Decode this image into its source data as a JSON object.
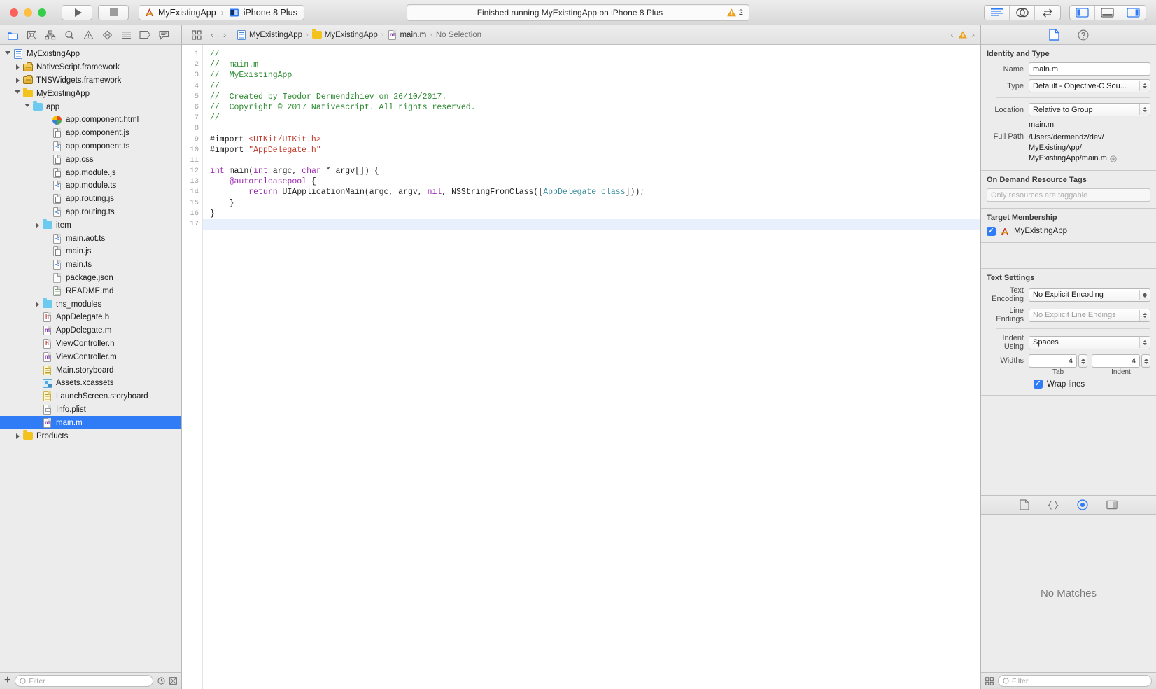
{
  "window": {
    "title": "MyExistingApp",
    "traffic_lights": [
      "close-red",
      "minimize-yellow",
      "zoom-green"
    ]
  },
  "toolbar": {
    "run_label": "Run",
    "stop_label": "Stop",
    "scheme_name": "MyExistingApp",
    "scheme_separator": "›",
    "destination": "iPhone 8 Plus",
    "status_message": "Finished running MyExistingApp on iPhone 8 Plus",
    "warning_count": "2",
    "editor_modes": [
      "standard-editor",
      "assistant-editor",
      "version-editor"
    ],
    "view_toggles": [
      "toggle-navigator",
      "toggle-debug-area",
      "toggle-utilities"
    ]
  },
  "navigator": {
    "tabs": [
      "project-navigator",
      "source-control-navigator",
      "symbol-navigator",
      "find-navigator",
      "issue-navigator",
      "test-navigator",
      "debug-navigator",
      "breakpoint-navigator",
      "report-navigator"
    ],
    "selected_tab": "project-navigator",
    "filter_placeholder": "Filter",
    "add_label": "+",
    "tree": [
      {
        "label": "MyExistingApp",
        "depth": 0,
        "icon": "project",
        "twisty": "open",
        "selected": false
      },
      {
        "label": "NativeScript.framework",
        "depth": 1,
        "icon": "framework",
        "twisty": "closed",
        "selected": false
      },
      {
        "label": "TNSWidgets.framework",
        "depth": 1,
        "icon": "framework",
        "twisty": "closed",
        "selected": false
      },
      {
        "label": "MyExistingApp",
        "depth": 1,
        "icon": "folder-yellow",
        "twisty": "open",
        "selected": false
      },
      {
        "label": "app",
        "depth": 2,
        "icon": "folder-blue",
        "twisty": "open",
        "selected": false
      },
      {
        "label": "app.component.html",
        "depth": 4,
        "icon": "html",
        "twisty": "none",
        "selected": false
      },
      {
        "label": "app.component.js",
        "depth": 4,
        "icon": "js",
        "twisty": "none",
        "selected": false
      },
      {
        "label": "app.component.ts",
        "depth": 4,
        "icon": "ts",
        "twisty": "none",
        "selected": false
      },
      {
        "label": "app.css",
        "depth": 4,
        "icon": "js",
        "twisty": "none",
        "selected": false
      },
      {
        "label": "app.module.js",
        "depth": 4,
        "icon": "js",
        "twisty": "none",
        "selected": false
      },
      {
        "label": "app.module.ts",
        "depth": 4,
        "icon": "ts",
        "twisty": "none",
        "selected": false
      },
      {
        "label": "app.routing.js",
        "depth": 4,
        "icon": "js",
        "twisty": "none",
        "selected": false
      },
      {
        "label": "app.routing.ts",
        "depth": 4,
        "icon": "ts",
        "twisty": "none",
        "selected": false
      },
      {
        "label": "item",
        "depth": 3,
        "icon": "folder-blue",
        "twisty": "closed",
        "selected": false
      },
      {
        "label": "main.aot.ts",
        "depth": 4,
        "icon": "ts",
        "twisty": "none",
        "selected": false
      },
      {
        "label": "main.js",
        "depth": 4,
        "icon": "js",
        "twisty": "none",
        "selected": false
      },
      {
        "label": "main.ts",
        "depth": 4,
        "icon": "ts",
        "twisty": "none",
        "selected": false
      },
      {
        "label": "package.json",
        "depth": 4,
        "icon": "json",
        "twisty": "none",
        "selected": false
      },
      {
        "label": "README.md",
        "depth": 4,
        "icon": "md",
        "twisty": "none",
        "selected": false
      },
      {
        "label": "tns_modules",
        "depth": 3,
        "icon": "folder-blue",
        "twisty": "closed",
        "selected": false
      },
      {
        "label": "AppDelegate.h",
        "depth": 3,
        "icon": "h",
        "twisty": "none",
        "selected": false
      },
      {
        "label": "AppDelegate.m",
        "depth": 3,
        "icon": "m",
        "twisty": "none",
        "selected": false
      },
      {
        "label": "ViewController.h",
        "depth": 3,
        "icon": "h",
        "twisty": "none",
        "selected": false
      },
      {
        "label": "ViewController.m",
        "depth": 3,
        "icon": "m",
        "twisty": "none",
        "selected": false
      },
      {
        "label": "Main.storyboard",
        "depth": 3,
        "icon": "storyboard",
        "twisty": "none",
        "selected": false
      },
      {
        "label": "Assets.xcassets",
        "depth": 3,
        "icon": "xcassets",
        "twisty": "none",
        "selected": false
      },
      {
        "label": "LaunchScreen.storyboard",
        "depth": 3,
        "icon": "storyboard",
        "twisty": "none",
        "selected": false
      },
      {
        "label": "Info.plist",
        "depth": 3,
        "icon": "plist",
        "twisty": "none",
        "selected": false
      },
      {
        "label": "main.m",
        "depth": 3,
        "icon": "m",
        "twisty": "none",
        "selected": true
      },
      {
        "label": "Products",
        "depth": 1,
        "icon": "folder-yellow",
        "twisty": "closed",
        "selected": false
      }
    ]
  },
  "editor": {
    "related_items_icon": "related-items-icon",
    "back_label": "‹",
    "forward_label": "›",
    "breadcrumbs": [
      {
        "label": "MyExistingApp",
        "icon": "project"
      },
      {
        "label": "MyExistingApp",
        "icon": "folder-yellow"
      },
      {
        "label": "main.m",
        "icon": "m"
      },
      {
        "label": "No Selection",
        "icon": "none"
      }
    ],
    "issue_prev": "‹",
    "issue_next": "›",
    "line_count": 17,
    "cursor_line": 17,
    "code_lines": [
      [
        {
          "t": "//",
          "c": "cm"
        }
      ],
      [
        {
          "t": "//  main.m",
          "c": "cm"
        }
      ],
      [
        {
          "t": "//  MyExistingApp",
          "c": "cm"
        }
      ],
      [
        {
          "t": "//",
          "c": "cm"
        }
      ],
      [
        {
          "t": "//  Created by Teodor Dermendzhiev on 26/10/2017.",
          "c": "cm"
        }
      ],
      [
        {
          "t": "//  Copyright © 2017 Nativescript. All rights reserved.",
          "c": "cm"
        }
      ],
      [
        {
          "t": "//",
          "c": "cm"
        }
      ],
      [],
      [
        {
          "t": "#import ",
          "c": "pp"
        },
        {
          "t": "<UIKit/UIKit.h>",
          "c": "str"
        }
      ],
      [
        {
          "t": "#import ",
          "c": "pp"
        },
        {
          "t": "\"AppDelegate.h\"",
          "c": "str"
        }
      ],
      [],
      [
        {
          "t": "int",
          "c": "kw"
        },
        {
          "t": " main(",
          "c": "pn"
        },
        {
          "t": "int",
          "c": "kw"
        },
        {
          "t": " argc, ",
          "c": "pn"
        },
        {
          "t": "char",
          "c": "kw"
        },
        {
          "t": " * argv[]) {",
          "c": "pn"
        }
      ],
      [
        {
          "t": "    ",
          "c": "pn"
        },
        {
          "t": "@autoreleasepool",
          "c": "kw"
        },
        {
          "t": " {",
          "c": "pn"
        }
      ],
      [
        {
          "t": "        ",
          "c": "pn"
        },
        {
          "t": "return",
          "c": "kw"
        },
        {
          "t": " UIApplicationMain(argc, argv, ",
          "c": "pn"
        },
        {
          "t": "nil",
          "c": "kw"
        },
        {
          "t": ", NSStringFromClass([",
          "c": "pn"
        },
        {
          "t": "AppDelegate class",
          "c": "cls"
        },
        {
          "t": "]));",
          "c": "pn"
        }
      ],
      [
        {
          "t": "    }",
          "c": "pn"
        }
      ],
      [
        {
          "t": "}",
          "c": "pn"
        }
      ],
      []
    ]
  },
  "inspector": {
    "tabs": [
      "file-inspector",
      "quick-help-inspector"
    ],
    "selected_tab": "file-inspector",
    "identity": {
      "title": "Identity and Type",
      "name_label": "Name",
      "name_value": "main.m",
      "type_label": "Type",
      "type_value": "Default - Objective-C Sou...",
      "location_label": "Location",
      "location_value": "Relative to Group",
      "location_filename": "main.m",
      "fullpath_label": "Full Path",
      "fullpath_lines": [
        "/Users/dermendz/dev/",
        "MyExistingApp/",
        "MyExistingApp/main.m"
      ]
    },
    "odr": {
      "title": "On Demand Resource Tags",
      "placeholder": "Only resources are taggable"
    },
    "target_membership": {
      "title": "Target Membership",
      "items": [
        {
          "label": "MyExistingApp",
          "checked": true
        }
      ]
    },
    "text_settings": {
      "title": "Text Settings",
      "encoding_label": "Text Encoding",
      "encoding_value": "No Explicit Encoding",
      "line_endings_label": "Line Endings",
      "line_endings_value": "No Explicit Line Endings",
      "indent_label": "Indent Using",
      "indent_value": "Spaces",
      "widths_label": "Widths",
      "tab_value": "4",
      "tab_caption": "Tab",
      "indent_width_value": "4",
      "indent_caption": "Indent",
      "wrap_label": "Wrap lines",
      "wrap_checked": true
    },
    "library": {
      "tabs": [
        "file-template-library",
        "code-snippet-library",
        "object-library",
        "media-library"
      ],
      "selected_tab": "object-library",
      "empty_message": "No Matches",
      "filter_placeholder": "Filter"
    }
  },
  "colors": {
    "accent": "#2F7CF6",
    "selection": "#2F7CF6",
    "comment": "#2C8A30",
    "keyword": "#9A29B0",
    "string": "#C2392B",
    "classname": "#3C8C9E",
    "warning": "#F5A623"
  }
}
